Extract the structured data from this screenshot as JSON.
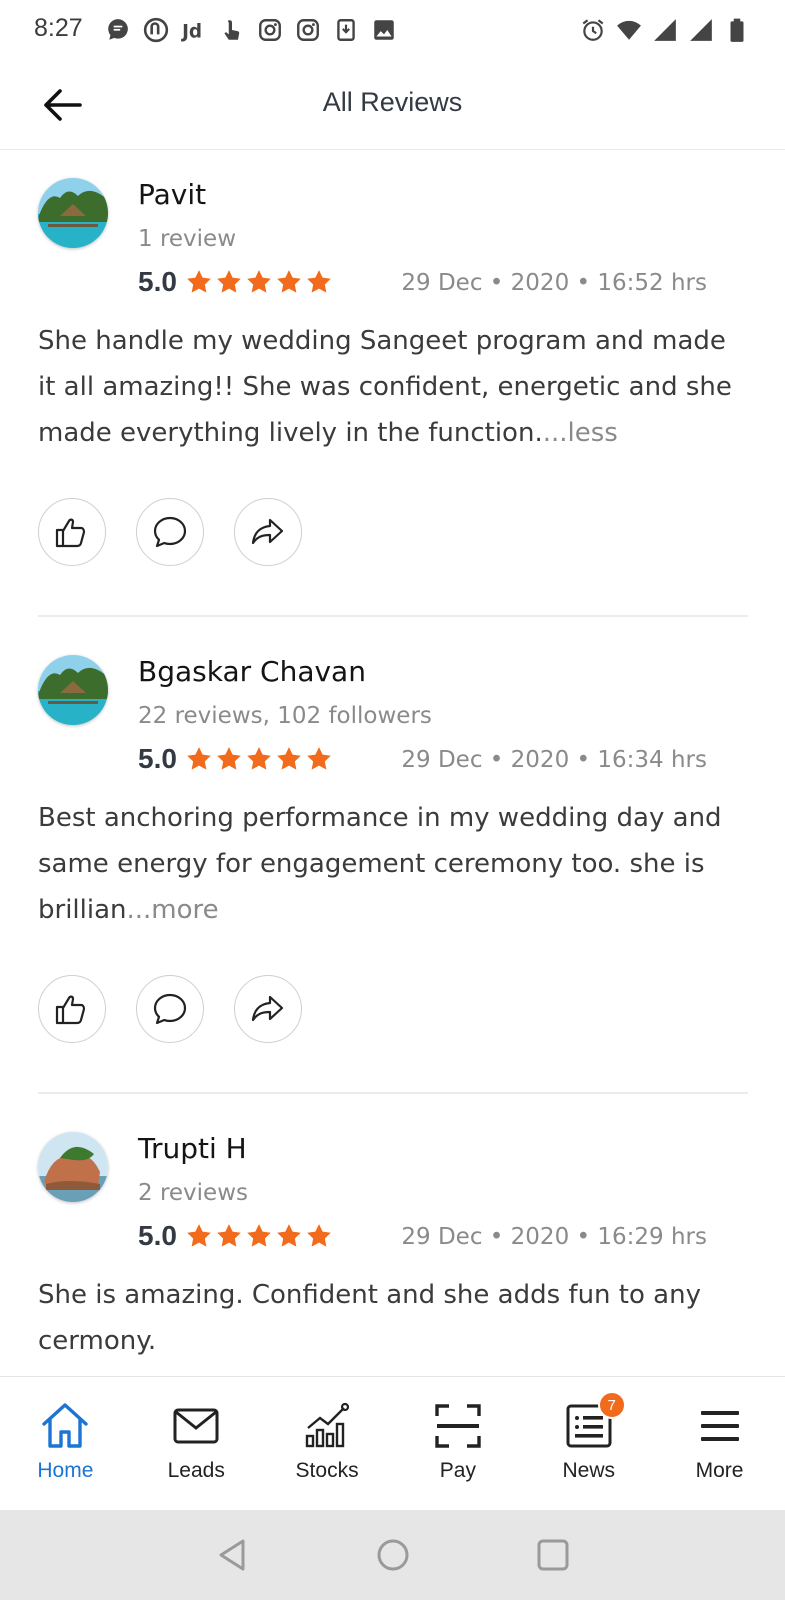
{
  "status_bar": {
    "time": "8:27",
    "left_icons": [
      "chat-bubble-icon",
      "brand-icon",
      "jd-icon",
      "tap-icon",
      "instagram-icon",
      "instagram-icon",
      "download-icon",
      "image-icon"
    ],
    "right_icons": [
      "alarm-icon",
      "wifi-icon",
      "signal-icon",
      "signal-icon",
      "battery-icon"
    ]
  },
  "header": {
    "title": "All Reviews",
    "back_icon": "arrow-left-icon"
  },
  "reviews": [
    {
      "name": "Pavit",
      "meta": "1 review",
      "score": "5.0",
      "stars": 5,
      "date": "29 Dec • 2020 • 16:52 hrs",
      "text": "She handle my wedding Sangeet program and made it all amazing!! She was confident, energetic and she made everything lively in the function.",
      "toggle": "...less"
    },
    {
      "name": "Bgaskar Chavan",
      "meta": "22 reviews, 102 followers",
      "score": "5.0",
      "stars": 5,
      "date": "29 Dec • 2020 • 16:34 hrs",
      "text": "Best anchoring performance in my wedding day and same energy for engagement ceremony too. she is brillian",
      "toggle": "...more"
    },
    {
      "name": "Trupti H",
      "meta": "2 reviews",
      "score": "5.0",
      "stars": 5,
      "date": "29 Dec • 2020 • 16:29 hrs",
      "text": "She is amazing. Confident and she adds fun to any cermony.",
      "toggle": ""
    }
  ],
  "bottom_nav": [
    {
      "label": "Home",
      "icon": "home-icon",
      "active": true
    },
    {
      "label": "Leads",
      "icon": "mail-icon"
    },
    {
      "label": "Stocks",
      "icon": "chart-icon"
    },
    {
      "label": "Pay",
      "icon": "scan-icon"
    },
    {
      "label": "News",
      "icon": "news-icon",
      "badge": "7"
    },
    {
      "label": "More",
      "icon": "menu-icon"
    }
  ],
  "colors": {
    "star": "#f26a1b",
    "accent": "#1c74d4",
    "badge": "#f26a1b"
  }
}
